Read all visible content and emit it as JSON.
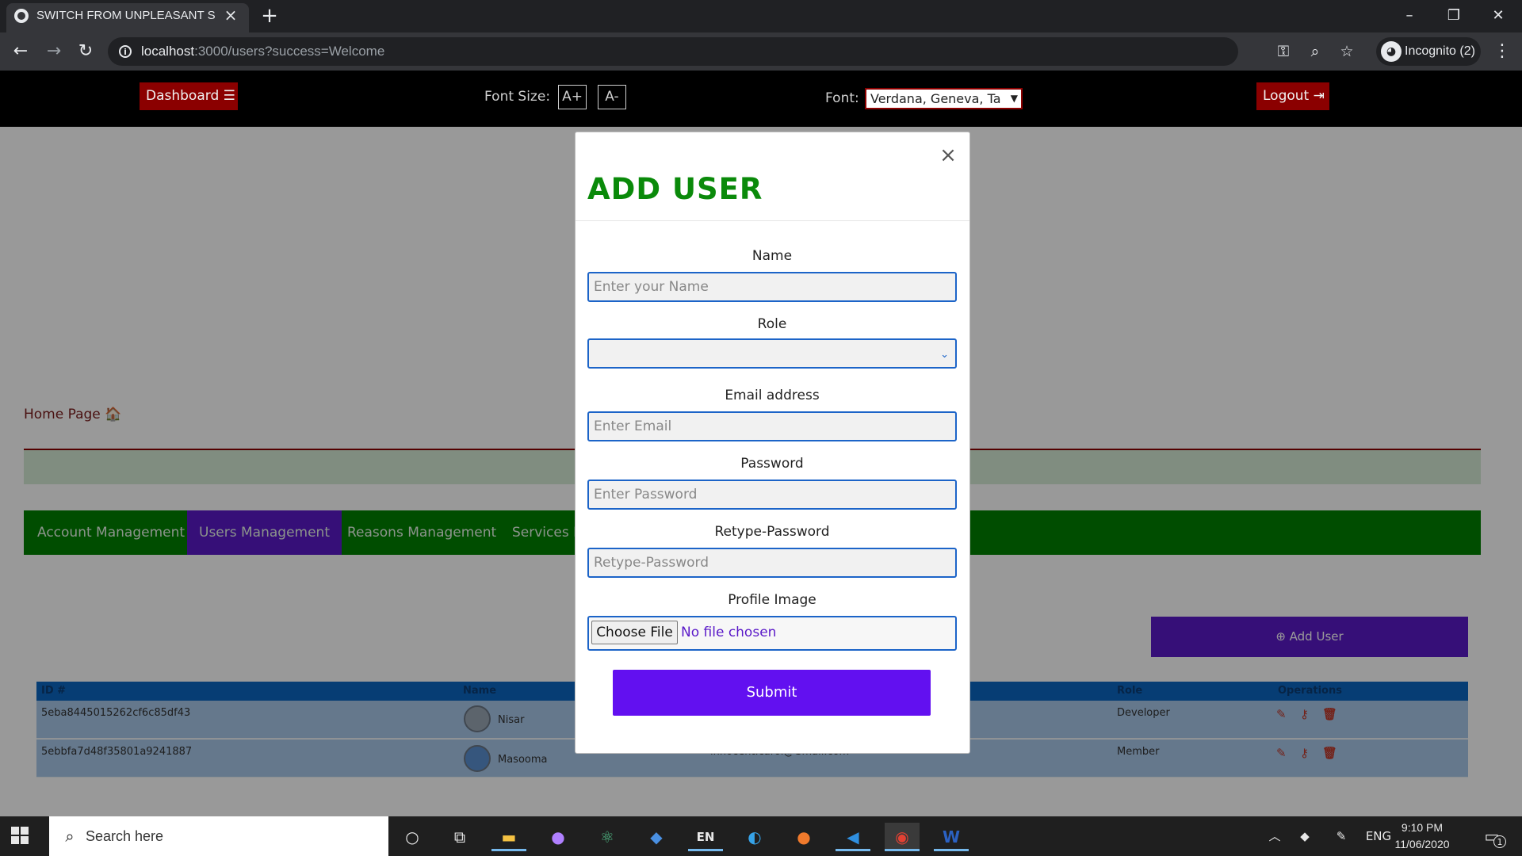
{
  "browser": {
    "tab_title": "SWITCH FROM UNPLEASANT SCENE",
    "url_host": "localhost",
    "url_rest": ":3000/users?success=Welcome",
    "incognito_label": "Incognito (2)"
  },
  "topnav": {
    "dashboard": "Dashboard ☰",
    "font_size_label": "Font Size:",
    "font_plus": "A+",
    "font_minus": "A-",
    "font_label": "Font:",
    "font_value": "Verdana, Geneva, Ta",
    "logout": "Logout ⇥"
  },
  "page": {
    "home_link": "Home Page 🏠",
    "tabs": [
      {
        "label": "Account Management"
      },
      {
        "label": "Users Management"
      },
      {
        "label": "Reasons Management"
      },
      {
        "label": "Services M"
      }
    ],
    "add_user": "⊕ Add User",
    "table": {
      "headers": [
        "ID #",
        "Name",
        "Role",
        "Operations"
      ],
      "rows": [
        {
          "id": "5eba8445015262cf6c85df43",
          "name": "Nisar",
          "role": "Developer"
        },
        {
          "id": "5ebbfa7d48f35801a9241887",
          "name": "Masooma",
          "email_partial": "innocent.carol@Gmail.com",
          "role": "Member"
        }
      ]
    }
  },
  "modal": {
    "title": "ADD USER",
    "close": "×",
    "name_label": "Name",
    "name_placeholder": "Enter your Name",
    "role_label": "Role",
    "role_value": "",
    "email_label": "Email address",
    "email_placeholder": "Enter Email",
    "password_label": "Password",
    "password_placeholder": "Enter Password",
    "retype_label": "Retype-Password",
    "retype_placeholder": "Retype-Password",
    "image_label": "Profile Image",
    "choose_file": "Choose File",
    "no_file": "No file chosen",
    "submit": "Submit"
  },
  "taskbar": {
    "search_placeholder": "Search here",
    "lang": "ENG",
    "time": "9:10 PM",
    "date": "11/06/2020",
    "notif_count": "1"
  },
  "colors": {
    "nav_bg": "#000000",
    "danger": "#8b0000",
    "green": "#008000",
    "purple": "#5a19c8",
    "submit": "#6210f0",
    "table_head": "#0a66c2"
  }
}
